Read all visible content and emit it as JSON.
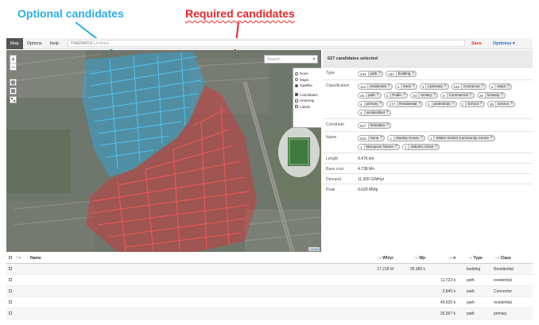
{
  "annotations": {
    "optional": "Optional candidates",
    "required": "Required candidates",
    "optional_color": "#2aaee8",
    "required_color": "#e8252a"
  },
  "appbar": {
    "tabs": [
      "Map",
      "Options",
      "Help"
    ],
    "active_tab": "Map",
    "app_name": "THERMOS",
    "project_title": "Untitled",
    "save_label": "Save",
    "optimise_label": "Optimise"
  },
  "map": {
    "search_placeholder": "Search...",
    "zoom_in": "+",
    "zoom_out": "−",
    "basemap_options": [
      "None",
      "Maps",
      "Satellite"
    ],
    "basemap_selected": "Satellite",
    "overlay_options": [
      {
        "label": "Candidates",
        "checked": true
      },
      {
        "label": "Heatmap",
        "checked": false
      },
      {
        "label": "Labels",
        "checked": false
      }
    ],
    "attribution": "Leaflet"
  },
  "panel": {
    "header": "627 candidates selected",
    "type": {
      "label": "Type",
      "chips": [
        {
          "n": "443",
          "t": "path"
        },
        {
          "n": "184",
          "t": "building"
        }
      ]
    },
    "classification": {
      "label": "Classification",
      "chips": [
        {
          "n": "114",
          "t": "residential"
        },
        {
          "n": "4",
          "t": "track"
        },
        {
          "n": "3",
          "t": "cycleway"
        },
        {
          "n": "183",
          "t": "Connector"
        },
        {
          "n": "4",
          "t": "steps"
        },
        {
          "n": "25",
          "t": "path"
        },
        {
          "n": "1",
          "t": "Public"
        },
        {
          "n": "24",
          "t": "tertiary"
        },
        {
          "n": "5",
          "t": "Commercial"
        },
        {
          "n": "29",
          "t": "footway"
        },
        {
          "n": "4",
          "t": "primary"
        },
        {
          "n": "177",
          "t": "Residential"
        },
        {
          "n": "2",
          "t": "pedestrian"
        },
        {
          "n": "1",
          "t": "School"
        },
        {
          "n": "49",
          "t": "service"
        },
        {
          "n": "2",
          "t": "unclassified"
        }
      ]
    },
    "constraint": {
      "label": "Constraint",
      "chips": [
        {
          "n": "627",
          "t": "forbidden"
        }
      ]
    },
    "name": {
      "label": "Name",
      "chips": [
        {
          "n": "623",
          "t": "None"
        },
        {
          "n": "1",
          "t": "Stanley House"
        },
        {
          "n": "1",
          "t": "Walter Sickert Community Centre"
        },
        {
          "n": "1",
          "t": "Marquess Tavern"
        },
        {
          "n": "1",
          "t": "Abbott's Close"
        }
      ]
    },
    "length": {
      "label": "Length",
      "value": "9.476 km"
    },
    "base_cost": {
      "label": "Base cost",
      "value": "4.738 M¤"
    },
    "demand": {
      "label": "Demand",
      "value": "11.305 GWh/yr"
    },
    "peak": {
      "label": "Peak",
      "value": "9.629 MWp"
    }
  },
  "table": {
    "headers": {
      "name": "Name",
      "wh": "Wh/yr",
      "wp": "Wp",
      "sym": "¤",
      "type": "Type",
      "cls": "Class"
    },
    "rows": [
      {
        "wh": "17.218 M",
        "wp": "30.385 k",
        "sym": "",
        "type": "building",
        "cls": "Residential"
      },
      {
        "wh": "",
        "wp": "",
        "sym": "11.723 k",
        "type": "path",
        "cls": "residential"
      },
      {
        "wh": "",
        "wp": "",
        "sym": "3.845 k",
        "type": "path",
        "cls": "Connector"
      },
      {
        "wh": "",
        "wp": "",
        "sym": "45.625 k",
        "type": "path",
        "cls": "residential"
      },
      {
        "wh": "",
        "wp": "",
        "sym": "26.557 k",
        "type": "path",
        "cls": "primary"
      }
    ]
  }
}
